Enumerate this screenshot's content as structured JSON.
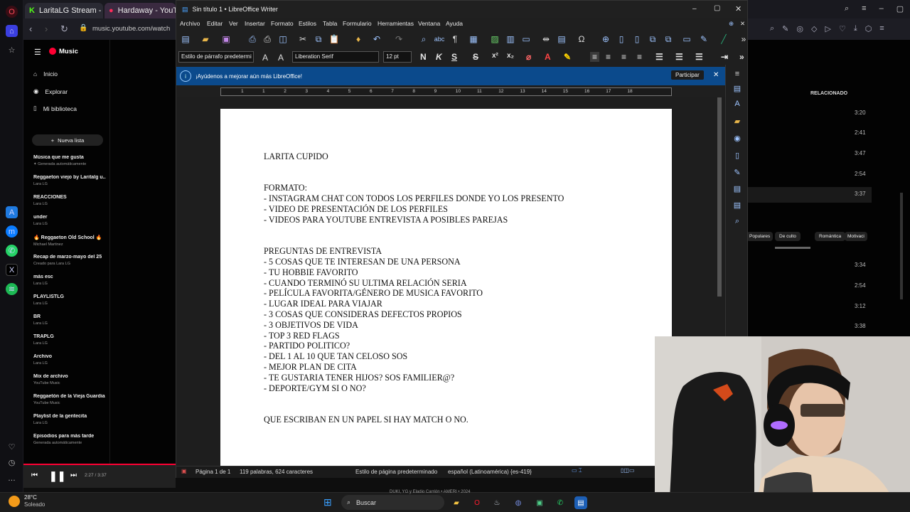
{
  "browser": {
    "tab1": "LaritaLG Stream - Watch L",
    "tab2": "Hardaway - YouTu",
    "url": "music.youtube.com/watch"
  },
  "ytmusic": {
    "logo": "Music",
    "nav": [
      "Inicio",
      "Explorar",
      "Mi biblioteca"
    ],
    "new_list": "Nueva lista",
    "playlists": [
      {
        "title": "Música que me gusta",
        "sub": "✦ Generada automáticamente"
      },
      {
        "title": "Reggaeton viejo by Laritalg u...",
        "sub": "Lara LG"
      },
      {
        "title": "REACCIONES",
        "sub": "Lara LG"
      },
      {
        "title": "under",
        "sub": "Lara LG"
      },
      {
        "title": "🔥 Reggaeton Old School 🔥",
        "sub": "Michael Martinez"
      },
      {
        "title": "Recap de marzo-mayo del 25",
        "sub": "Creado para Lara LG"
      },
      {
        "title": "más esc",
        "sub": "Lara LG"
      },
      {
        "title": "PLAYLISTLG",
        "sub": "Lara LG"
      },
      {
        "title": "BR",
        "sub": "Lara LG"
      },
      {
        "title": "TRAPLG",
        "sub": "Lara LG"
      },
      {
        "title": "Archivo",
        "sub": "Lara LG"
      },
      {
        "title": "Mix de archivo",
        "sub": "YouTube Music"
      },
      {
        "title": "Reggaetón de la Vieja Guardia",
        "sub": "YouTube Music"
      },
      {
        "title": "Playlist de la gentecita",
        "sub": "Lara LG"
      },
      {
        "title": "Episodios para más tarde",
        "sub": "Generada automáticamente"
      }
    ],
    "player_time": "2:27 / 3:37"
  },
  "right_panel": {
    "title": "RELACIONADO",
    "durations": [
      "3:20",
      "2:41",
      "3:47",
      "2:54",
      "3:37",
      "3:34",
      "2:54",
      "3:12",
      "3:38"
    ],
    "chips": [
      "Populares",
      "De culto",
      "Romántica",
      "Motivaci"
    ]
  },
  "writer": {
    "title": "Sin título 1 • LibreOffice Writer",
    "menu": [
      "Archivo",
      "Editar",
      "Ver",
      "Insertar",
      "Formato",
      "Estilos",
      "Tabla",
      "Formulario",
      "Herramientas",
      "Ventana",
      "Ayuda"
    ],
    "para_style": "Estilo de párrafo predetermi",
    "font": "Liberation Serif",
    "size": "12 pt",
    "infobar": "¡Ayúdenos a mejorar aún más LibreOffice!",
    "infobar_btn": "Participar",
    "doc_lines": [
      "LARITA CUPIDO",
      "",
      "",
      "FORMATO:",
      "- INSTAGRAM CHAT CON TODOS LOS PERFILES DONDE YO LOS PRESENTO",
      "- VIDEO DE PRESENTACIÓN DE LOS PERFILES",
      "- VIDEOS PARA YOUTUBE ENTREVISTA A POSIBLES PAREJAS",
      "",
      "",
      "PREGUNTAS DE ENTREVISTA",
      "- 5 COSAS QUE TE INTERESAN DE UNA PERSONA",
      "- TU HOBBIE FAVORITO",
      "- CUANDO TERMINÓ SU ULTIMA RELACIÓN SERIA",
      "- PELÍCULA FAVORITA/GÉNERO DE MUSICA FAVORITO",
      "- LUGAR IDEAL PARA VIAJAR",
      "- 3 COSAS QUE CONSIDERAS DEFECTOS PROPIOS",
      "- 3 OBJETIVOS DE VIDA",
      "- TOP 3 RED FLAGS",
      "- PARTIDO POLITICO?",
      "- DEL 1 AL 10 QUE TAN CELOSO SOS",
      "- MEJOR PLAN DE CITA",
      "- TE GUSTARIA TENER HIJOS? SOS FAMILIER@?",
      "- DEPORTE/GYM SI O NO?",
      "",
      "",
      "QUE ESCRIBAN EN UN PAPEL SI HAY MATCH O NO."
    ],
    "status": {
      "page": "Página 1 de 1",
      "words": "119 palabras, 624 caracteres",
      "style": "Estilo de página predeterminado",
      "lang": "español (Latinoamérica) {es-419}"
    },
    "ruler_nums": [
      "1",
      "1",
      "2",
      "3",
      "4",
      "5",
      "6",
      "7",
      "8",
      "9",
      "10",
      "11",
      "12",
      "13",
      "14",
      "15",
      "16",
      "17",
      "18"
    ]
  },
  "taskbar": {
    "temp": "28°C",
    "weather": "Soleado",
    "search": "Buscar",
    "now_playing": "DUKI, YG y Eladio Carrión • AMERI • 2024"
  }
}
